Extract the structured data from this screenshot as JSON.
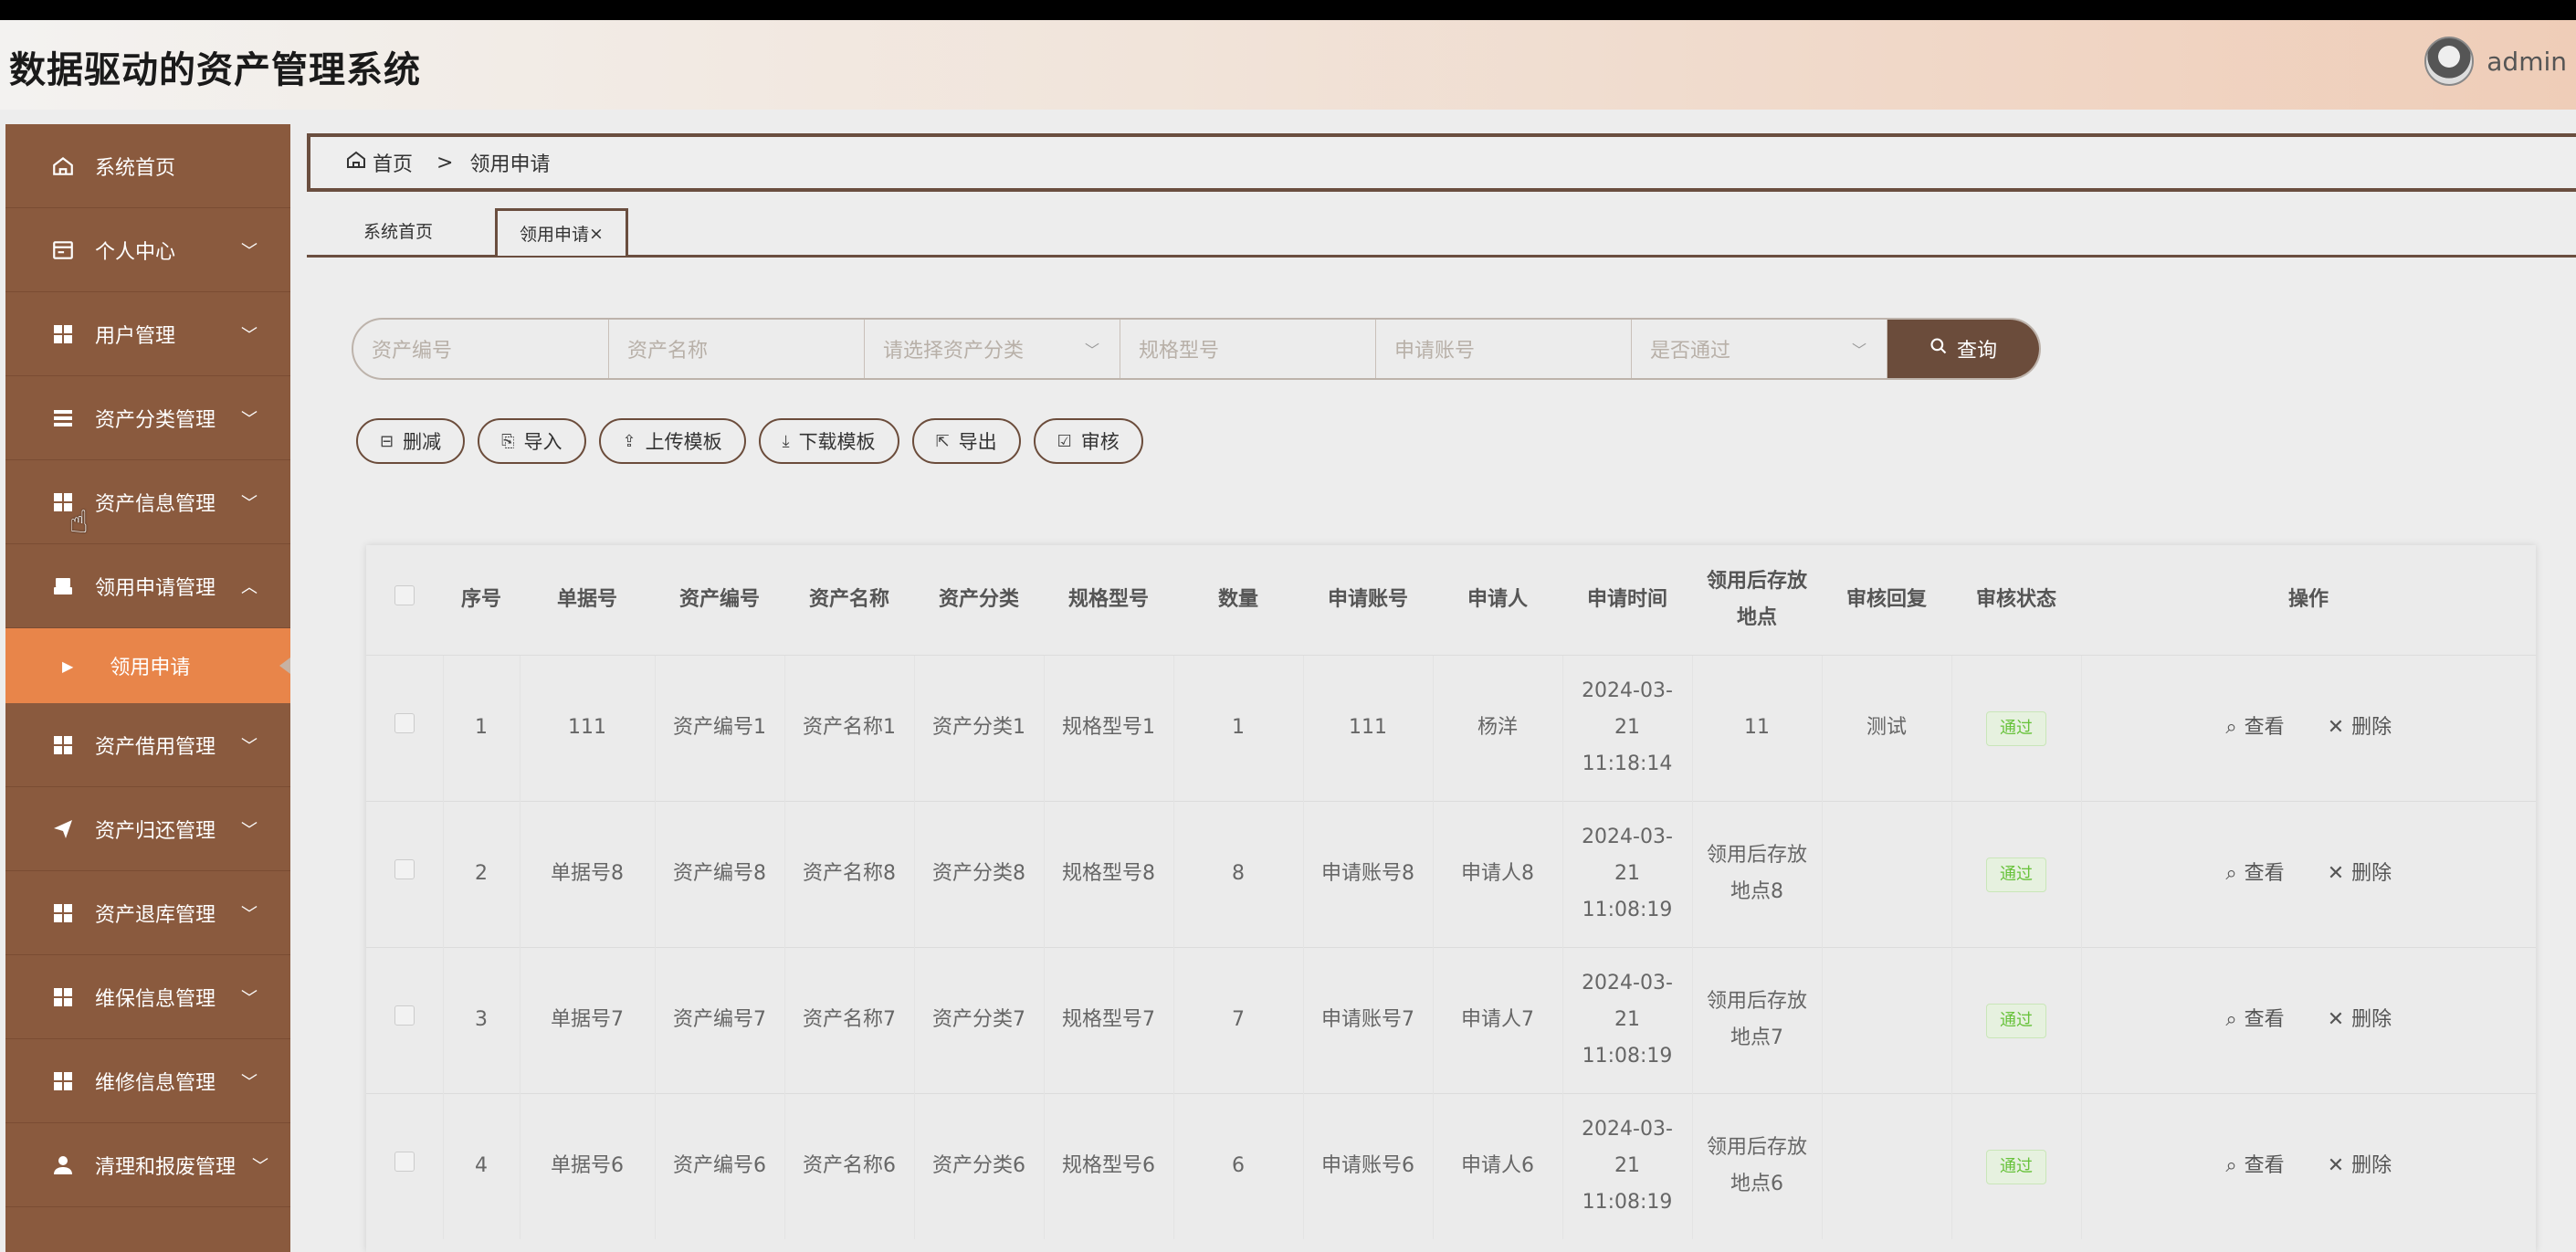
{
  "header": {
    "title": "数据驱动的资产管理系统",
    "username": "admin"
  },
  "sidebar": {
    "items": [
      {
        "label": "系统首页",
        "icon": "home-icon",
        "has_chevron": false
      },
      {
        "label": "个人中心",
        "icon": "card-icon",
        "has_chevron": true
      },
      {
        "label": "用户管理",
        "icon": "grid-icon",
        "has_chevron": true
      },
      {
        "label": "资产分类管理",
        "icon": "list-icon",
        "has_chevron": true
      },
      {
        "label": "资产信息管理",
        "icon": "grid-icon",
        "has_chevron": true
      },
      {
        "label": "领用申请管理",
        "icon": "printer-icon",
        "has_chevron": true,
        "expanded": true
      }
    ],
    "sub_item": {
      "label": "领用申请"
    },
    "items_after": [
      {
        "label": "资产借用管理",
        "icon": "grid-icon"
      },
      {
        "label": "资产归还管理",
        "icon": "send-icon"
      },
      {
        "label": "资产退库管理",
        "icon": "grid-icon"
      },
      {
        "label": "维保信息管理",
        "icon": "grid-icon"
      },
      {
        "label": "维修信息管理",
        "icon": "grid-icon"
      },
      {
        "label": "清理和报废管理",
        "icon": "user-icon"
      }
    ]
  },
  "breadcrumb": {
    "home": "首页",
    "separator": ">",
    "current": "领用申请"
  },
  "tabs": [
    {
      "label": "系统首页"
    },
    {
      "label": "领用申请",
      "close": "×"
    }
  ],
  "search": {
    "asset_no": "资产编号",
    "asset_name": "资产名称",
    "category": "请选择资产分类",
    "spec": "规格型号",
    "account": "申请账号",
    "passed": "是否通过",
    "query_label": "查询"
  },
  "actions": {
    "delete": "删减",
    "import": "导入",
    "upload": "上传模板",
    "download": "下载模板",
    "export": "导出",
    "review": "审核"
  },
  "table": {
    "headers": {
      "index": "序号",
      "doc_no": "单据号",
      "asset_no": "资产编号",
      "asset_name": "资产名称",
      "category": "资产分类",
      "spec": "规格型号",
      "qty": "数量",
      "account": "申请账号",
      "applicant": "申请人",
      "time": "申请时间",
      "location": "领用后存放地点",
      "reply": "审核回复",
      "status": "审核状态",
      "ops": "操作"
    },
    "ops": {
      "view": "查看",
      "delete": "删除"
    },
    "rows": [
      {
        "index": "1",
        "doc_no": "111",
        "asset_no": "资产编号1",
        "asset_name": "资产名称1",
        "category": "资产分类1",
        "spec": "规格型号1",
        "qty": "1",
        "account": "111",
        "applicant": "杨洋",
        "time": "2024-03-21 11:18:14",
        "location": "11",
        "reply": "测试",
        "status": "通过"
      },
      {
        "index": "2",
        "doc_no": "单据号8",
        "asset_no": "资产编号8",
        "asset_name": "资产名称8",
        "category": "资产分类8",
        "spec": "规格型号8",
        "qty": "8",
        "account": "申请账号8",
        "applicant": "申请人8",
        "time": "2024-03-21 11:08:19",
        "location": "领用后存放地点8",
        "reply": "",
        "status": "通过"
      },
      {
        "index": "3",
        "doc_no": "单据号7",
        "asset_no": "资产编号7",
        "asset_name": "资产名称7",
        "category": "资产分类7",
        "spec": "规格型号7",
        "qty": "7",
        "account": "申请账号7",
        "applicant": "申请人7",
        "time": "2024-03-21 11:08:19",
        "location": "领用后存放地点7",
        "reply": "",
        "status": "通过"
      },
      {
        "index": "4",
        "doc_no": "单据号6",
        "asset_no": "资产编号6",
        "asset_name": "资产名称6",
        "category": "资产分类6",
        "spec": "规格型号6",
        "qty": "6",
        "account": "申请账号6",
        "applicant": "申请人6",
        "time": "2024-03-21 11:08:19",
        "location": "领用后存放地点6",
        "reply": "",
        "status": "通过"
      }
    ]
  },
  "colors": {
    "sidebar": "#8a5a3e",
    "sidebar_active": "#e8854a",
    "accent_dark": "#6b4c3b",
    "status_green": "#67c23a"
  }
}
